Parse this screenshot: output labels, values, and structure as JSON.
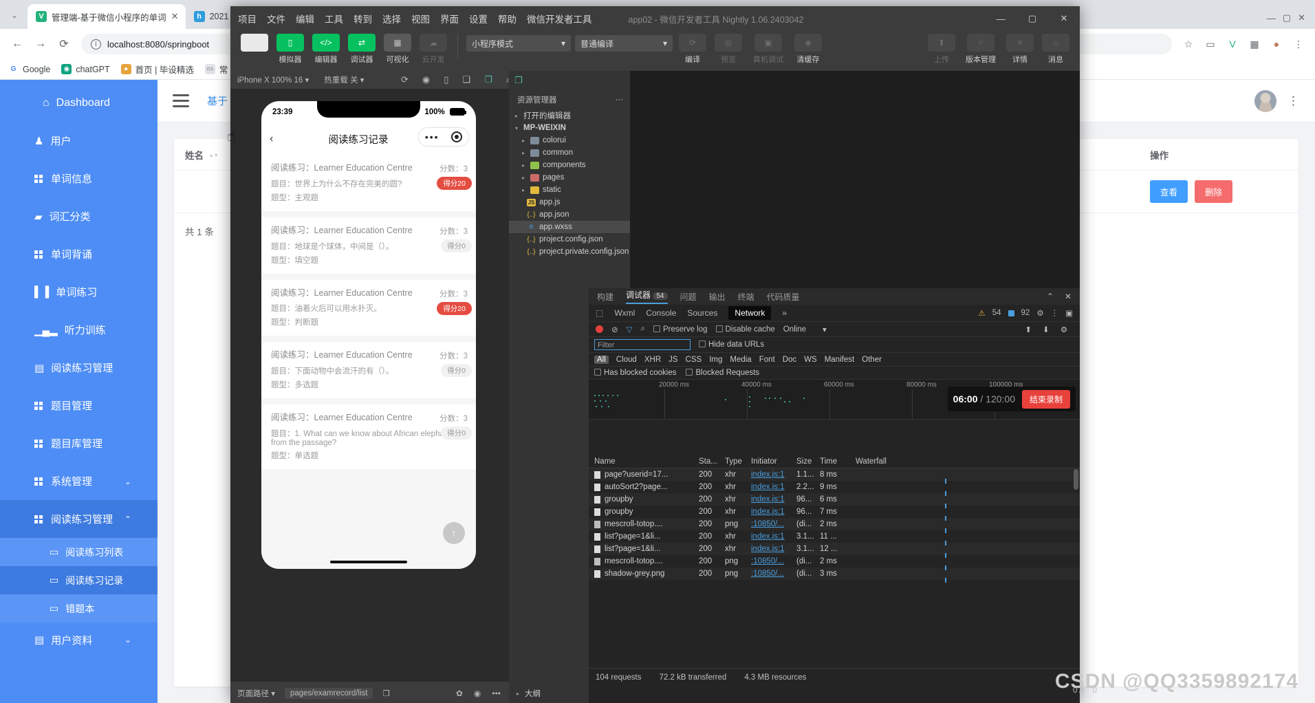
{
  "browser": {
    "tabs": [
      {
        "title": "管理端-基于微信小程序的单词",
        "favicon": "V",
        "favicon_color": "#23b27a",
        "active": true
      },
      {
        "title": "2021",
        "favicon": "h",
        "favicon_color": "#2d9cdb",
        "active": false
      },
      {
        "title": "",
        "favicon": "",
        "favicon_color": "#1aad19",
        "active": false
      }
    ],
    "url": "localhost:8080/springboot",
    "back_icon": "←",
    "forward_icon": "→",
    "reload_icon": "⟳",
    "star_icon": "☆",
    "profile_icon": "◉",
    "menu_icon": "⋮",
    "bookmarks": [
      {
        "label": "Google",
        "ico": "G",
        "color": "#ffffff"
      },
      {
        "label": "chatGPT",
        "ico": "◉",
        "color": "#10a37f"
      },
      {
        "label": "首页 | 毕设精选",
        "ico": "●",
        "color": "#e8a33d"
      },
      {
        "label": "常",
        "ico": "▭",
        "color": "#dfe3e8"
      }
    ]
  },
  "admin": {
    "sidebar": {
      "items": [
        {
          "label": "Dashboard",
          "icon": "home-icon"
        },
        {
          "label": "用户",
          "icon": "user-icon"
        },
        {
          "label": "单词信息",
          "icon": "grid-icon"
        },
        {
          "label": "词汇分类",
          "icon": "briefcase-icon"
        },
        {
          "label": "单词背诵",
          "icon": "grid-icon"
        },
        {
          "label": "单词练习",
          "icon": "book-icon"
        },
        {
          "label": "听力训练",
          "icon": "chart-icon"
        },
        {
          "label": "阅读练习管理",
          "icon": "doc-icon"
        },
        {
          "label": "题目管理",
          "icon": "grid-icon"
        },
        {
          "label": "题目库管理",
          "icon": "grid-icon"
        },
        {
          "label": "系统管理",
          "icon": "grid-icon",
          "chevron": "⌄"
        },
        {
          "label": "阅读练习管理",
          "icon": "grid-icon",
          "chevron": "⌃",
          "active": true
        }
      ],
      "subitems": [
        {
          "label": "阅读练习列表",
          "icon": "folder-icon",
          "active": false
        },
        {
          "label": "阅读练习记录",
          "icon": "folder-icon",
          "active": true
        },
        {
          "label": "错题本",
          "icon": "folder-icon",
          "active": false
        }
      ],
      "footer_item": {
        "label": "用户资料",
        "icon": "id-icon",
        "chevron": "⌄"
      }
    },
    "topbar": {
      "breadcrumb": "基于",
      "menu_icon": "hamburger-icon",
      "kebab": "⋮"
    },
    "table": {
      "columns": [
        "姓名",
        "操作"
      ],
      "rows": [
        {
          "name": "",
          "actions": [
            "查看",
            "删除"
          ]
        }
      ],
      "total_text": "共 1 条"
    }
  },
  "devtools": {
    "menu": [
      "项目",
      "文件",
      "编辑",
      "工具",
      "转到",
      "选择",
      "视图",
      "界面",
      "设置",
      "帮助",
      "微信开发者工具"
    ],
    "window_title": "app02 - 微信开发者工具 Nightly 1.06.2403042",
    "window_controls": {
      "minimize": "—",
      "maximize": "▢",
      "close": "✕"
    },
    "toolbar": {
      "buttons": [
        {
          "label": "模拟器",
          "glyph": "▯",
          "style": "green"
        },
        {
          "label": "编辑器",
          "glyph": "</>",
          "style": "green"
        },
        {
          "label": "调试器",
          "glyph": "⇄",
          "style": "green"
        },
        {
          "label": "可视化",
          "glyph": "▦",
          "style": "grey"
        },
        {
          "label": "云开发",
          "glyph": "☁",
          "style": "ghost"
        }
      ],
      "mode_select": "小程序模式",
      "compile_select": "普通编译",
      "right_buttons": [
        {
          "label": "编译",
          "glyph": "⟳"
        },
        {
          "label": "预览",
          "glyph": "◎"
        },
        {
          "label": "真机调试",
          "glyph": "▣"
        },
        {
          "label": "清缓存",
          "glyph": "◈"
        }
      ],
      "far_right_buttons": [
        {
          "label": "上传",
          "glyph": "⬆"
        },
        {
          "label": "版本管理",
          "glyph": "⑂"
        },
        {
          "label": "详情",
          "glyph": "≡"
        },
        {
          "label": "消息",
          "glyph": "🔔"
        }
      ]
    },
    "simulator_bar": {
      "device": "iPhone X 100% 16 ▾",
      "hotreload": "热重载 关 ▾",
      "icons": [
        "refresh-icon",
        "record-icon",
        "device-icon",
        "copy-icon",
        "page-icon",
        "search-icon"
      ]
    },
    "simulator_icons2": [
      "layout-icon",
      "grid-icon",
      "paint-icon",
      "export-icon"
    ],
    "phone": {
      "status_time": "23:39",
      "battery_pct": "100%",
      "nav_title": "阅读练习记录",
      "back_icon": "back-icon",
      "records": [
        {
          "title": "阅读练习：Learner Education Centre",
          "question": "题目：世界上为什么不存在完美的圆?",
          "type": "题型：主观题",
          "score_label": "分数：3",
          "badge": "得分20",
          "badge_style": "red"
        },
        {
          "title": "阅读练习：Learner Education Centre",
          "question": "题目：地球是个球体，中间是（）。",
          "type": "题型：填空题",
          "score_label": "分数：3",
          "badge": "得分0",
          "badge_style": "grey"
        },
        {
          "title": "阅读练习：Learner Education Centre",
          "question": "题目：油着火后可以用水扑灭。",
          "type": "题型：判断题",
          "score_label": "分数：3",
          "badge": "得分20",
          "badge_style": "red"
        },
        {
          "title": "阅读练习：Learner Education Centre",
          "question": "题目：下面动物中会流汗的有（）。",
          "type": "题型：多选题",
          "score_label": "分数：3",
          "badge": "得分0",
          "badge_style": "grey"
        },
        {
          "title": "阅读练习：Learner Education Centre",
          "question": "题目：1. What can we know about African elephants from the passage?",
          "type": "题型：单选题",
          "score_label": "分数：3",
          "badge": "得分0",
          "badge_style": "grey"
        }
      ],
      "totop_icon": "↑"
    },
    "path_bar": {
      "label": "页面路径 ▾",
      "path": "pages/examrecord/list",
      "copy_icon": "copy-icon",
      "icons": [
        "bug-icon",
        "eye-icon",
        "more-icon"
      ]
    },
    "explorer": {
      "title": "资源管理器",
      "more": "···",
      "open_editors": "打开的编辑器",
      "project": "MP-WEIXIN",
      "tree": [
        {
          "label": "colorui",
          "kind": "folder",
          "color": "blue",
          "twisty": "▸"
        },
        {
          "label": "common",
          "kind": "folder",
          "color": "blue",
          "twisty": "▸"
        },
        {
          "label": "components",
          "kind": "folder",
          "color": "green",
          "twisty": "▸"
        },
        {
          "label": "pages",
          "kind": "folder",
          "color": "red",
          "twisty": "▸"
        },
        {
          "label": "static",
          "kind": "folder",
          "color": "yellow",
          "twisty": "▸"
        },
        {
          "label": "app.js",
          "kind": "js"
        },
        {
          "label": "app.json",
          "kind": "json"
        },
        {
          "label": "app.wxss",
          "kind": "wxss",
          "selected": true
        },
        {
          "label": "project.config.json",
          "kind": "json"
        },
        {
          "label": "project.private.config.json",
          "kind": "json"
        }
      ],
      "outline": "大纲"
    },
    "debugger": {
      "tabs": [
        {
          "label": "构建"
        },
        {
          "label": "调试器",
          "badge": "54",
          "active": true
        },
        {
          "label": "问题"
        },
        {
          "label": "输出"
        },
        {
          "label": "终端"
        },
        {
          "label": "代码质量"
        }
      ],
      "collapse_icon": "⌃",
      "close_icon": "✕",
      "panels": [
        "Wxml",
        "Console",
        "Sources",
        "Network"
      ],
      "panels_active": "Network",
      "overflow": "»",
      "warnings": "54",
      "infos": "92",
      "gear_icon": "⚙",
      "kebab_icon": "⋮",
      "dock_icon": "▣",
      "network_controls": {
        "preserve_log": "Preserve log",
        "disable_cache": "Disable cache",
        "throttle": "Online",
        "filter_placeholder": "Filter",
        "hide_data_urls": "Hide data URLs",
        "types": [
          "All",
          "Cloud",
          "XHR",
          "JS",
          "CSS",
          "Img",
          "Media",
          "Font",
          "Doc",
          "WS",
          "Manifest",
          "Other"
        ],
        "types_active": "All",
        "has_blocked_cookies": "Has blocked cookies",
        "blocked_requests": "Blocked Requests"
      },
      "overview_ticks": [
        "20000 ms",
        "40000 ms",
        "60000 ms",
        "80000 ms",
        "100000 ms"
      ],
      "recording": {
        "elapsed": "06:00",
        "total": "120:00",
        "stop_label": "结束录制"
      },
      "table": {
        "columns": [
          "Name",
          "Sta...",
          "Type",
          "Initiator",
          "Size",
          "Time",
          "Waterfall"
        ],
        "rows": [
          {
            "name": "page?userid=17...",
            "status": "200",
            "type": "xhr",
            "initiator": "index.js:1",
            "size": "1.1...",
            "time": "8 ms",
            "kind": "doc"
          },
          {
            "name": "autoSort2?page...",
            "status": "200",
            "type": "xhr",
            "initiator": "index.js:1",
            "size": "2.2...",
            "time": "9 ms",
            "kind": "doc"
          },
          {
            "name": "groupby",
            "status": "200",
            "type": "xhr",
            "initiator": "index.js:1",
            "size": "96...",
            "time": "6 ms",
            "kind": "doc"
          },
          {
            "name": "groupby",
            "status": "200",
            "type": "xhr",
            "initiator": "index.js:1",
            "size": "96...",
            "time": "7 ms",
            "kind": "doc"
          },
          {
            "name": "mescroll-totop....",
            "status": "200",
            "type": "png",
            "initiator": ":10850/...",
            "size": "(di...",
            "time": "2 ms",
            "kind": "img"
          },
          {
            "name": "list?page=1&li...",
            "status": "200",
            "type": "xhr",
            "initiator": "index.js:1",
            "size": "3.1...",
            "time": "11 ...",
            "kind": "doc"
          },
          {
            "name": "list?page=1&li...",
            "status": "200",
            "type": "xhr",
            "initiator": "index.js:1",
            "size": "3.1...",
            "time": "12 ...",
            "kind": "doc"
          },
          {
            "name": "mescroll-totop....",
            "status": "200",
            "type": "png",
            "initiator": ":10850/...",
            "size": "(di...",
            "time": "2 ms",
            "kind": "img"
          },
          {
            "name": "shadow-grey.png",
            "status": "200",
            "type": "png",
            "initiator": ":10850/...",
            "size": "(di...",
            "time": "3 ms",
            "kind": "img"
          }
        ],
        "footer": {
          "requests": "104 requests",
          "transferred": "72.2 kB transferred",
          "resources": "4.3 MB resources"
        }
      },
      "status_counts": {
        "errors": "0 A",
        "warnings": "0"
      }
    }
  },
  "watermark": "CSDN @QQ3359892174",
  "colors": {
    "sidebar": "#4e8df5",
    "sidebar_active": "#3d7be0",
    "accent_blue": "#409eff",
    "danger_red": "#f56c6c",
    "wechat_green": "#07c160",
    "badge_red": "#e54d42"
  }
}
